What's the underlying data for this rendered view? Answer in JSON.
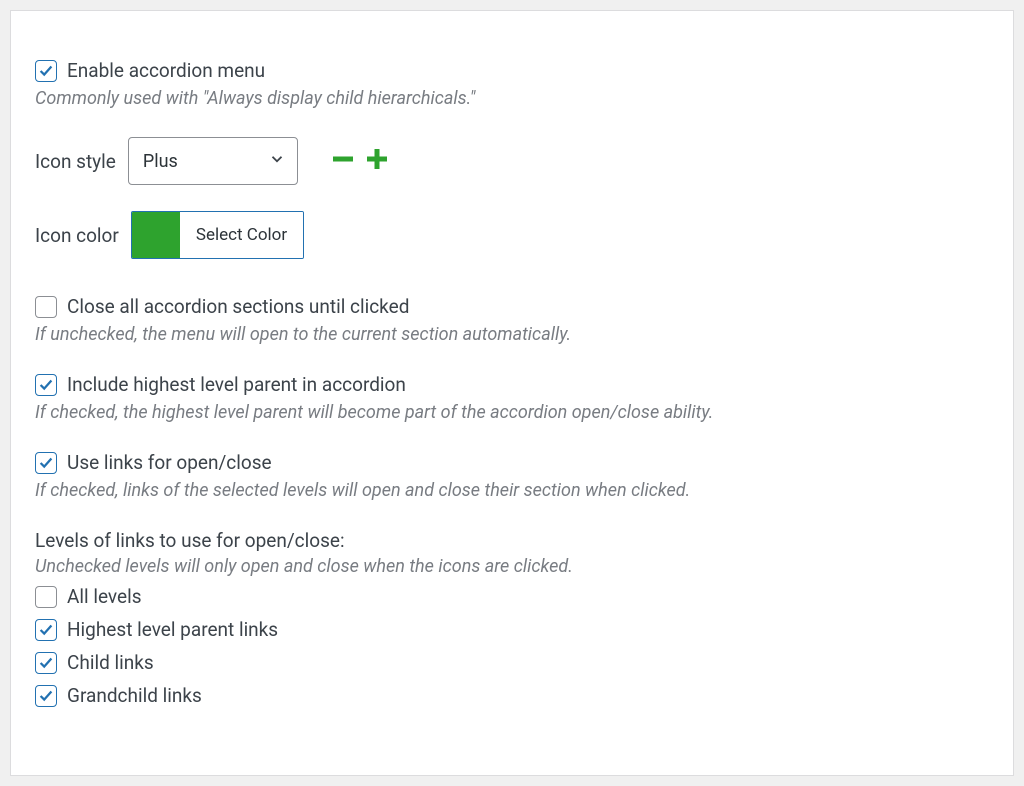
{
  "enable": {
    "label": "Enable accordion menu",
    "helper": "Commonly used with \"Always display child hierarchicals.\"",
    "checked": true
  },
  "icon_style": {
    "label": "Icon style",
    "value": "Plus"
  },
  "icon_color": {
    "label": "Icon color",
    "button_text": "Select Color",
    "value": "#2ea32e"
  },
  "close_all": {
    "label": "Close all accordion sections until clicked",
    "helper": "If unchecked, the menu will open to the current section automatically.",
    "checked": false
  },
  "include_parent": {
    "label": "Include highest level parent in accordion",
    "helper": "If checked, the highest level parent will become part of the accordion open/close ability.",
    "checked": true
  },
  "use_links": {
    "label": "Use links for open/close",
    "helper": "If checked, links of the selected levels will open and close their section when clicked.",
    "checked": true
  },
  "levels": {
    "heading": "Levels of links to use for open/close:",
    "helper": "Unchecked levels will only open and close when the icons are clicked.",
    "items": [
      {
        "label": "All levels",
        "checked": false
      },
      {
        "label": "Highest level parent links",
        "checked": true
      },
      {
        "label": "Child links",
        "checked": true
      },
      {
        "label": "Grandchild links",
        "checked": true
      }
    ]
  }
}
